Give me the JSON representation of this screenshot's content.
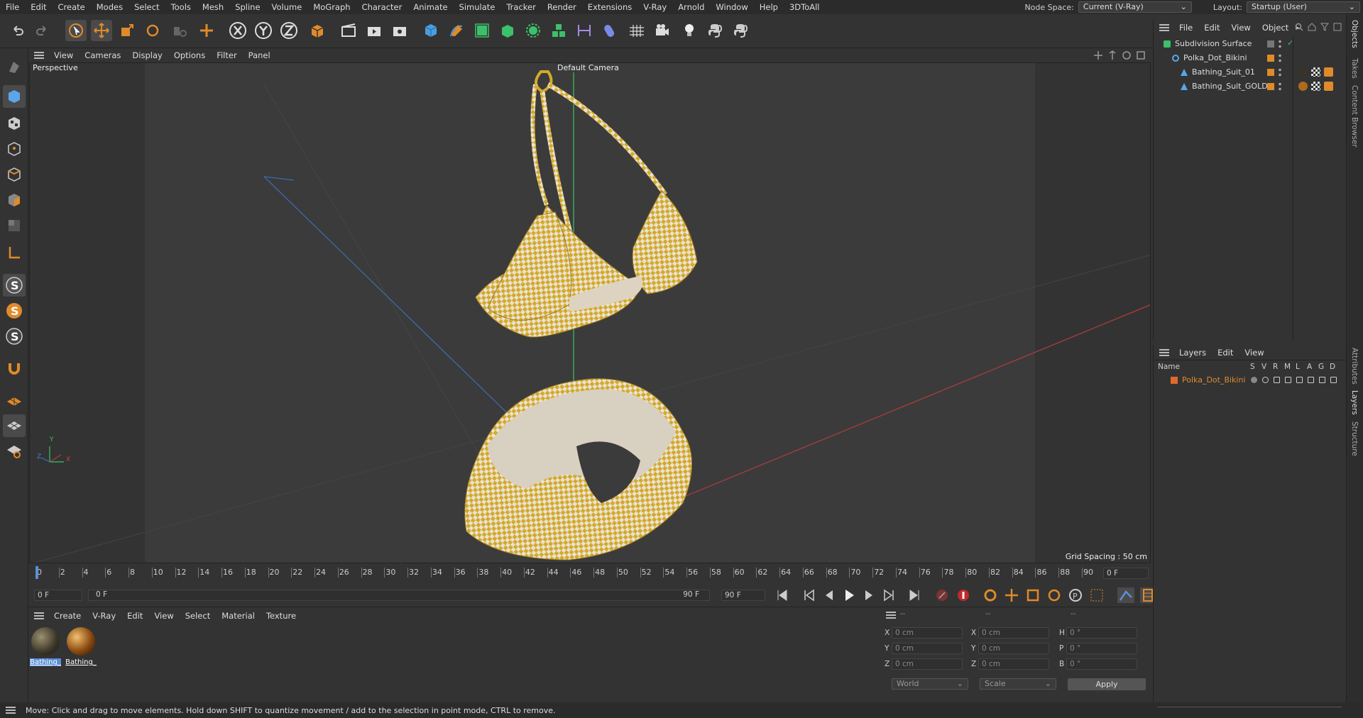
{
  "menu": [
    "File",
    "Edit",
    "Create",
    "Modes",
    "Select",
    "Tools",
    "Mesh",
    "Spline",
    "Volume",
    "MoGraph",
    "Character",
    "Animate",
    "Simulate",
    "Tracker",
    "Render",
    "Extensions",
    "V-Ray",
    "Arnold",
    "Window",
    "Help",
    "3DToAll"
  ],
  "node_space": {
    "label": "Node Space:",
    "value": "Current (V-Ray)"
  },
  "layout": {
    "label": "Layout:",
    "value": "Startup (User)"
  },
  "viewport": {
    "menu": [
      "View",
      "Cameras",
      "Display",
      "Options",
      "Filter",
      "Panel"
    ],
    "name": "Perspective",
    "camera": "Default Camera",
    "grid_spacing": "Grid Spacing : 50 cm",
    "axis_labels": {
      "x": "X",
      "y": "Y",
      "z": "Z"
    }
  },
  "timeline": {
    "ticks": [
      "0",
      "2",
      "4",
      "6",
      "8",
      "10",
      "12",
      "14",
      "16",
      "18",
      "20",
      "22",
      "24",
      "26",
      "28",
      "30",
      "32",
      "34",
      "36",
      "38",
      "40",
      "42",
      "44",
      "46",
      "48",
      "50",
      "52",
      "54",
      "56",
      "58",
      "60",
      "62",
      "64",
      "66",
      "68",
      "70",
      "72",
      "74",
      "76",
      "78",
      "80",
      "82",
      "84",
      "86",
      "88",
      "90"
    ],
    "current_frame": "0 F"
  },
  "transport": {
    "start": "0 F",
    "range_start": "0 F",
    "range_end": "90 F",
    "end": "90 F"
  },
  "materials": {
    "menu": [
      "Create",
      "V-Ray",
      "Edit",
      "View",
      "Select",
      "Material",
      "Texture"
    ],
    "items": [
      {
        "label": "Bathing_"
      },
      {
        "label": "Bathing_"
      }
    ]
  },
  "coords": {
    "headers": [
      "--",
      "--",
      "--"
    ],
    "rows": [
      {
        "a": "X",
        "av": "0 cm",
        "b": "X",
        "bv": "0 cm",
        "c": "H",
        "cv": "0 °"
      },
      {
        "a": "Y",
        "av": "0 cm",
        "b": "Y",
        "bv": "0 cm",
        "c": "P",
        "cv": "0 °"
      },
      {
        "a": "Z",
        "av": "0 cm",
        "b": "Z",
        "bv": "0 cm",
        "c": "B",
        "cv": "0 °"
      }
    ],
    "space": "World",
    "mode": "Scale",
    "apply": "Apply"
  },
  "objects": {
    "menu": [
      "File",
      "Edit",
      "View",
      "Object"
    ],
    "items": [
      {
        "name": "Subdivision Surface",
        "indent": 0
      },
      {
        "name": "Polka_Dot_Bikini",
        "indent": 1
      },
      {
        "name": "Bathing_Suit_01",
        "indent": 2
      },
      {
        "name": "Bathing_Suit_GOLD",
        "indent": 2
      }
    ]
  },
  "layers": {
    "menu": [
      "Layers",
      "Edit",
      "View"
    ],
    "col_name": "Name",
    "cols": [
      "S",
      "V",
      "R",
      "M",
      "L",
      "A",
      "G",
      "D"
    ],
    "items": [
      {
        "name": "Polka_Dot_Bikini",
        "color": "#e06a2a"
      }
    ]
  },
  "sidetabs": [
    "Objects",
    "Takes",
    "Content Browser",
    "Attributes",
    "Layers",
    "Structure"
  ],
  "status": "Move: Click and drag to move elements. Hold down SHIFT to quantize movement / add to the selection in point mode, CTRL to remove.",
  "colors": {
    "accent": "#e08a2a",
    "selection": "#5b8fd9",
    "axis_x": "#c84848",
    "axis_y": "#3cc06a",
    "axis_z": "#4a7fd0"
  }
}
